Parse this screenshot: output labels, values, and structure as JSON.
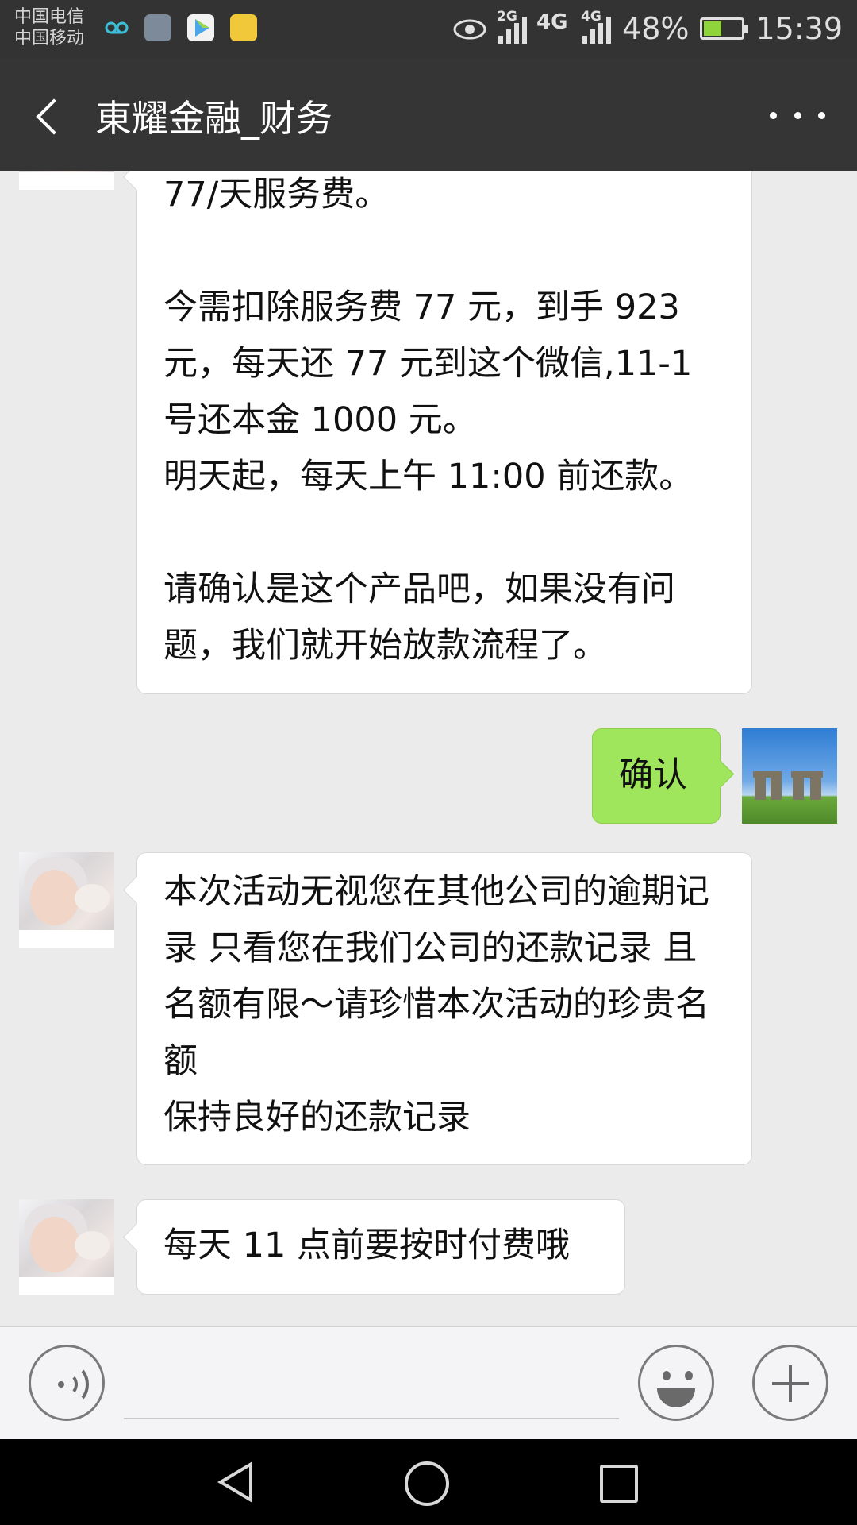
{
  "status_bar": {
    "carrier_1": "中国电信",
    "carrier_2": "中国移动",
    "notification_icons": [
      "voicemail-icon",
      "gallery-icon",
      "video-player-icon",
      "pp-app-icon"
    ],
    "network_1": "2G",
    "network_2": "4G",
    "network_3": "4G",
    "battery": "48%",
    "battery_level": 0.48,
    "time": "15:39"
  },
  "header": {
    "title": "東耀金融_财务"
  },
  "messages": [
    {
      "side": "left",
      "text": "77/天服务费。\n\n今需扣除服务费 77 元，到手 923 元，每天还 77 元到这个微信,11-1 号还本金 1000 元。\n明天起，每天上午 11:00 前还款。\n\n请确认是这个产品吧，如果没有问题，我们就开始放款流程了。"
    },
    {
      "side": "right",
      "text": "确认"
    },
    {
      "side": "left",
      "text": "本次活动无视您在其他公司的逾期记录 只看您在我们公司的还款记录 且名额有限～请珍惜本次活动的珍贵名额\n保持良好的还款记录"
    },
    {
      "side": "left",
      "text": "每天 11 点前要按时付费哦"
    }
  ],
  "colors": {
    "status_bar_bg": "#333333",
    "title_bar_bg": "#353535",
    "chat_bg": "#ebebeb",
    "sent_bubble": "#9fe65c",
    "received_bubble": "#ffffff",
    "battery_fill": "#8fd43a"
  }
}
